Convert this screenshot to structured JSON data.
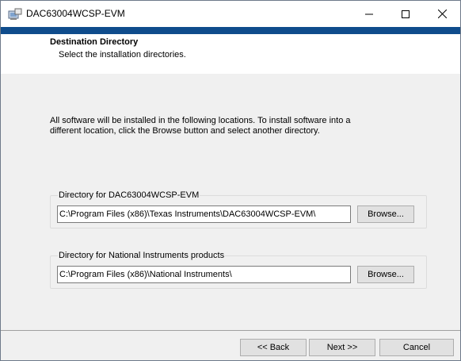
{
  "window": {
    "title": "DAC63004WCSP-EVM",
    "app_icon": "installer-icon",
    "controls": {
      "minimize": "minimize-icon",
      "maximize": "maximize-icon",
      "close": "close-icon"
    }
  },
  "colors": {
    "accent": "#0f4c8c",
    "window_bg": "#f0f0f0",
    "panel_bg": "#ffffff"
  },
  "header": {
    "title": "Destination Directory",
    "subtitle": "Select the installation directories."
  },
  "intro_text": "All software will be installed in the following locations. To install software into a different location, click the Browse button and select another directory.",
  "directories": [
    {
      "label": "Directory for DAC63004WCSP-EVM",
      "path": "C:\\Program Files (x86)\\Texas Instruments\\DAC63004WCSP-EVM\\",
      "browse_label": "Browse..."
    },
    {
      "label": "Directory for National Instruments products",
      "path": "C:\\Program Files (x86)\\National Instruments\\",
      "browse_label": "Browse..."
    }
  ],
  "footer": {
    "back_label": "<< Back",
    "next_label": "Next >>",
    "cancel_label": "Cancel"
  }
}
